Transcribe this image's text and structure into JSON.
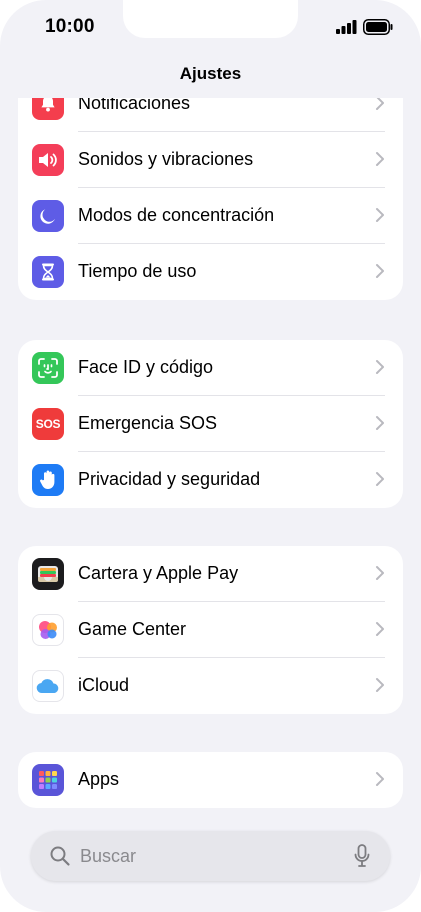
{
  "status_bar": {
    "time": "10:00"
  },
  "nav": {
    "title": "Ajustes"
  },
  "groups": [
    {
      "items": [
        {
          "label": "Notificaciones",
          "icon": "bell-icon",
          "color": "#f43e4d"
        },
        {
          "label": "Sonidos y vibraciones",
          "icon": "speaker-icon",
          "color": "#f43e59"
        },
        {
          "label": "Modos de concentración",
          "icon": "moon-icon",
          "color": "#5e5ce6"
        },
        {
          "label": "Tiempo de uso",
          "icon": "hourglass-icon",
          "color": "#5e5ce6"
        }
      ]
    },
    {
      "items": [
        {
          "label": "Face ID y código",
          "icon": "face-id-icon",
          "color": "#34c759"
        },
        {
          "label": "Emergencia SOS",
          "icon": "sos-icon",
          "icon_text": "SOS",
          "color": "#ef3b3b"
        },
        {
          "label": "Privacidad y seguridad",
          "icon": "hand-icon",
          "color": "#1e7bf5"
        }
      ]
    },
    {
      "items": [
        {
          "label": "Cartera y Apple Pay",
          "icon": "wallet-icon",
          "color": "#1c1c1e"
        },
        {
          "label": "Game Center",
          "icon": "game-center-icon",
          "color": "#ffffff"
        },
        {
          "label": "iCloud",
          "icon": "icloud-icon",
          "color": "#ffffff"
        }
      ]
    },
    {
      "items": [
        {
          "label": "Apps",
          "icon": "apps-grid-icon",
          "color": "#5a55d8"
        }
      ]
    }
  ],
  "search": {
    "placeholder": "Buscar"
  }
}
